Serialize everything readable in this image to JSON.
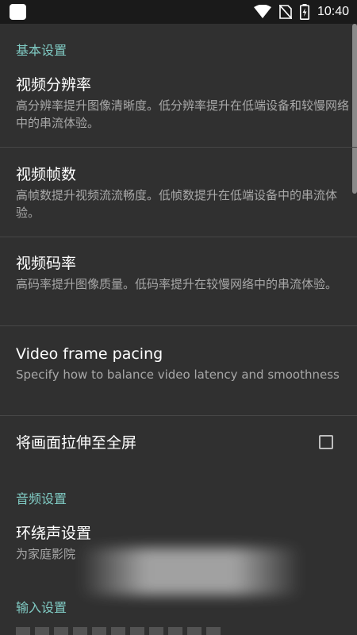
{
  "status_bar": {
    "time": "10:40",
    "icons": [
      "app-notification-icon",
      "wifi-icon",
      "no-sim-icon",
      "battery-charging-icon"
    ]
  },
  "sections": {
    "basic": {
      "header": "基本设置",
      "resolution": {
        "title": "视频分辨率",
        "summary": "高分辨率提升图像清晰度。低分辨率提升在低端设备和较慢网络中的串流体验。"
      },
      "fps": {
        "title": "视频帧数",
        "summary": "高帧数提升视频流流畅度。低帧数提升在低端设备中的串流体验。"
      },
      "bitrate": {
        "title": "视频码率",
        "summary": "高码率提升图像质量。低码率提升在较慢网络中的串流体验。"
      },
      "frame_pacing": {
        "title": "Video frame pacing",
        "summary": "Specify how to balance video latency and smoothness"
      },
      "stretch": {
        "title": "将画面拉伸至全屏",
        "checked": false
      }
    },
    "audio": {
      "header": "音频设置",
      "surround": {
        "title": "环绕声设置",
        "summary": "为家庭影院"
      }
    },
    "input": {
      "header": "输入设置"
    }
  },
  "colors": {
    "accent": "#80cbc4",
    "background": "#303030",
    "status_bar": "#1a1a1a",
    "primary_text": "#ffffff",
    "secondary_text": "#a8a8a8"
  }
}
